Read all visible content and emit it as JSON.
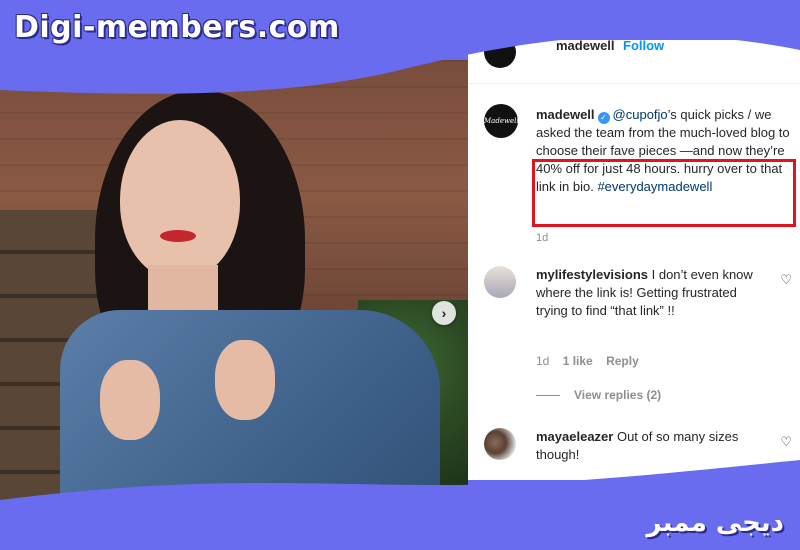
{
  "branding": {
    "top_text": "Digi-members.com",
    "bottom_text": "دیجی ممبر",
    "color": "#6a6cf0"
  },
  "header": {
    "username": "madewell",
    "follow_label": "Follow"
  },
  "post": {
    "avatar_text": "Madewell",
    "username": "madewell",
    "mention": "@cupofjo",
    "caption_part1": "’s quick picks / we asked the team from the much-loved blog to choose their fave pieces —and now they’re 40% off for just 48 hours. hurry over to that link in bio.",
    "hashtag": "#everydaymadewell",
    "time": "1d",
    "highlight_color": "#e0141e"
  },
  "comments": [
    {
      "username": "mylifestylevisions",
      "text": "I don’t even know where the link is! Getting frustrated trying to find “that link” !!",
      "time": "1d",
      "likes": "1 like",
      "reply_label": "Reply",
      "view_replies": "View replies (2)",
      "icon": "heart-icon"
    },
    {
      "username": "mayaeleazer",
      "text": "Out of so many sizes though!",
      "icon": "heart-icon"
    }
  ],
  "carousel": {
    "next_icon": "chevron-right-icon",
    "next_glyph": "›"
  }
}
